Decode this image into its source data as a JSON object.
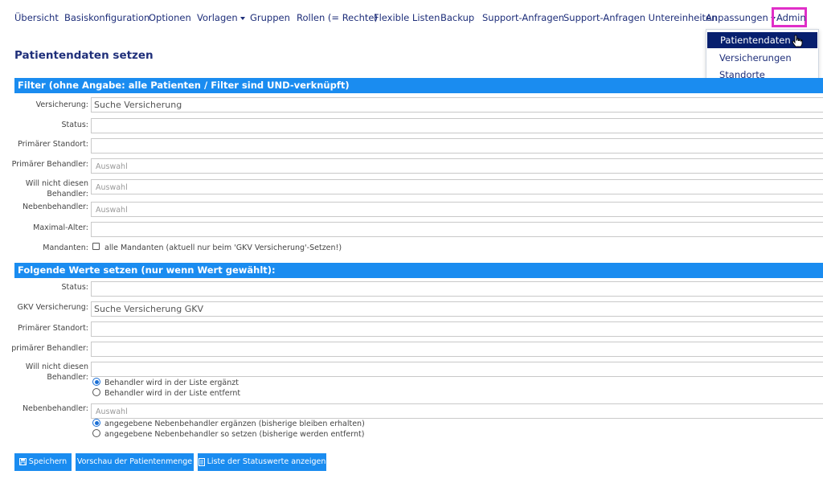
{
  "nav": {
    "items": [
      "Übersicht",
      "Basiskonfiguration",
      "Optionen",
      "Vorlagen",
      "Gruppen",
      "Rollen (= Rechte)",
      "Flexible Listen",
      "Backup",
      "Support-Anfragen",
      "Support-Anfragen Untereinheiten",
      "Anpassungen",
      "Admin"
    ]
  },
  "dropdown": {
    "items": [
      "Patientendaten",
      "Versicherungen",
      "Standorte"
    ]
  },
  "page": {
    "title": "Patientendaten setzen"
  },
  "filter": {
    "title": "Filter (ohne Angabe: alle Patienten / Filter sind UND-verknüpft)",
    "versicherung_label": "Versicherung:",
    "versicherung_value": "Suche Versicherung",
    "status_label": "Status:",
    "standort_label": "Primärer Standort:",
    "behandler_label": "Primärer Behandler:",
    "behandler_placeholder": "Auswahl",
    "will_nicht_label_1": "Will nicht diesen",
    "will_nicht_label_2": "Behandler:",
    "will_nicht_placeholder": "Auswahl",
    "neben_label": "Nebenbehandler:",
    "neben_placeholder": "Auswahl",
    "alter_label": "Maximal-Alter:",
    "mandanten_label": "Mandanten:",
    "mandanten_text": "alle Mandanten (aktuell nur beim 'GKV Versicherung'-Setzen!)"
  },
  "set": {
    "title": "Folgende Werte setzen (nur wenn Wert gewählt):",
    "status_label": "Status:",
    "gkv_label": "GKV Versicherung:",
    "gkv_value": "Suche Versicherung GKV",
    "standort_label": "Primärer Standort:",
    "behandler_label": "primärer Behandler:",
    "will_nicht_label_1": "Will nicht diesen",
    "will_nicht_label_2": "Behandler:",
    "will_opt1": "Behandler wird in der Liste ergänzt",
    "will_opt2": "Behandler wird in der Liste entfernt",
    "neben_label": "Nebenbehandler:",
    "neben_placeholder": "Auswahl",
    "neben_opt1": "angegebene Nebenbehandler ergänzen (bisherige bleiben erhalten)",
    "neben_opt2": "angegebene Nebenbehandler so setzen (bisherige werden entfernt)"
  },
  "buttons": {
    "save": "Speichern",
    "preview": "Vorschau der Patientenmenge",
    "list": "Liste der Statuswerte anzeigen"
  },
  "colors": {
    "accent": "#1a8cf0",
    "nav_text": "#1f2f7a",
    "highlight": "#e02fc8",
    "dropdown_active": "#071f6e"
  }
}
